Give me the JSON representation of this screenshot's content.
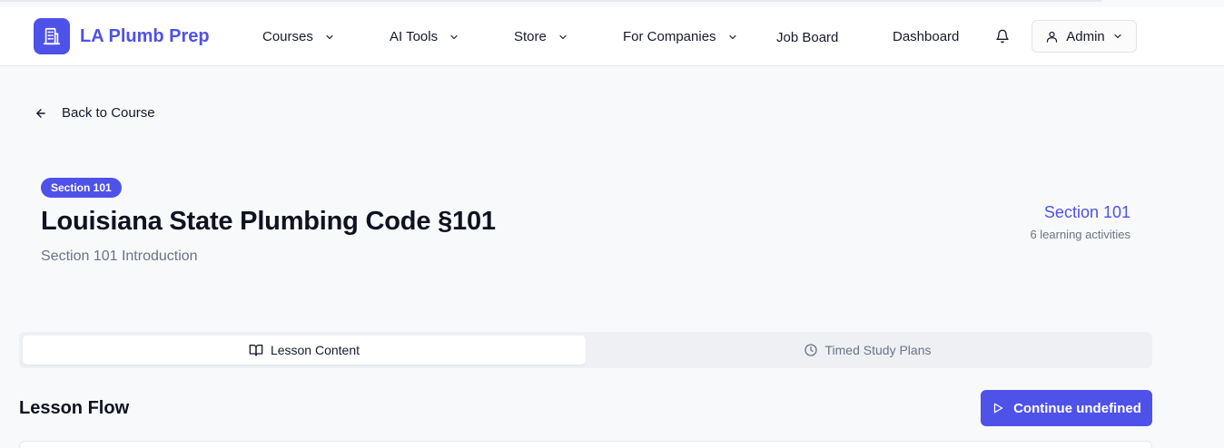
{
  "header": {
    "brand": "LA Plumb Prep",
    "nav": [
      {
        "label": "Courses",
        "has_dropdown": true
      },
      {
        "label": "AI Tools",
        "has_dropdown": true
      },
      {
        "label": "Store",
        "has_dropdown": true
      },
      {
        "label": "For Companies",
        "has_dropdown": true
      },
      {
        "label": "Job Board",
        "has_dropdown": false
      },
      {
        "label": "Dashboard",
        "has_dropdown": false
      }
    ],
    "notification_icon": "bell-icon",
    "user_menu": {
      "label": "Admin",
      "icon": "user-icon"
    }
  },
  "back_link": {
    "label": "Back to Course",
    "icon": "arrow-left-icon"
  },
  "lesson": {
    "badge": "Section 101",
    "title": "Louisiana State Plumbing Code §101",
    "subtitle": "Section 101 Introduction",
    "section_label": "Section 101",
    "activities": "6 learning activities"
  },
  "tabs": [
    {
      "label": "Lesson Content",
      "icon": "book-open-icon",
      "active": true
    },
    {
      "label": "Timed Study Plans",
      "icon": "clock-icon",
      "active": false
    }
  ],
  "flow": {
    "title": "Lesson Flow",
    "continue_label": "Continue undefined",
    "continue_icon": "play-icon"
  },
  "colors": {
    "accent": "#4f52e8",
    "background": "#f8f9fb",
    "muted_text": "#6b7386"
  }
}
